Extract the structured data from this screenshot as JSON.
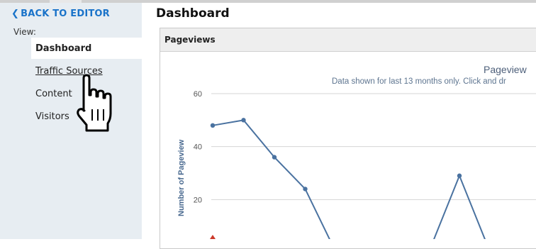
{
  "sidebar": {
    "back_label": "BACK TO EDITOR",
    "view_label": "View:",
    "items": [
      {
        "label": "Dashboard",
        "active": true
      },
      {
        "label": "Traffic Sources",
        "active": false
      },
      {
        "label": "Content",
        "active": false
      },
      {
        "label": "Visitors",
        "active": false
      }
    ]
  },
  "main": {
    "title": "Dashboard",
    "panel_title": "Pageviews"
  },
  "colors": {
    "accent": "#1a73c9",
    "series": "#4a72a0",
    "sidebar_bg": "#e7edf2"
  },
  "chart_data": {
    "type": "line",
    "title": "Pageview",
    "subtitle": "Data shown for last 13 months only. Click and dr",
    "ylabel": "Number of Pageview",
    "xlabel": "",
    "y_ticks": [
      "60",
      "40",
      "20"
    ],
    "ylim": [
      0,
      60
    ],
    "grid": true,
    "series": [
      {
        "name": "",
        "values": [
          48,
          50,
          36,
          24,
          0,
          null,
          null,
          0,
          29,
          0
        ]
      }
    ]
  }
}
